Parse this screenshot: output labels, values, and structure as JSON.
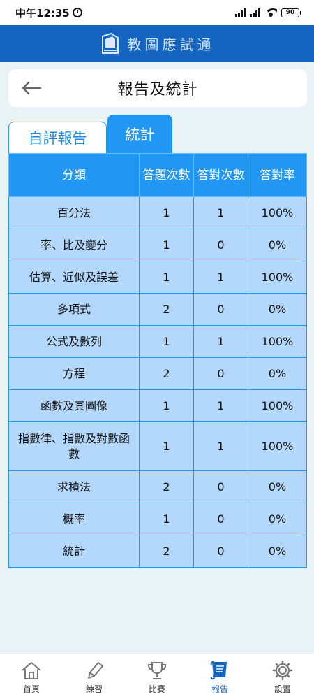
{
  "status_bar": {
    "time": "中午12:35",
    "battery": "90"
  },
  "header": {
    "app_title": "教圖應試通"
  },
  "page": {
    "title": "報告及統計"
  },
  "tabs": [
    {
      "label": "自評報告",
      "active": false
    },
    {
      "label": "統計",
      "active": true
    }
  ],
  "table": {
    "headers": [
      "分類",
      "答題次數",
      "答對次數",
      "答對率"
    ],
    "rows": [
      {
        "category": "百分法",
        "attempts": "1",
        "correct": "1",
        "rate": "100%"
      },
      {
        "category": "率、比及變分",
        "attempts": "1",
        "correct": "0",
        "rate": "0%"
      },
      {
        "category": "估算、近似及誤差",
        "attempts": "1",
        "correct": "1",
        "rate": "100%"
      },
      {
        "category": "多項式",
        "attempts": "2",
        "correct": "0",
        "rate": "0%"
      },
      {
        "category": "公式及數列",
        "attempts": "1",
        "correct": "1",
        "rate": "100%"
      },
      {
        "category": "方程",
        "attempts": "2",
        "correct": "0",
        "rate": "0%"
      },
      {
        "category": "函數及其圖像",
        "attempts": "1",
        "correct": "1",
        "rate": "100%"
      },
      {
        "category": "指數律、指數及對數函數",
        "attempts": "1",
        "correct": "1",
        "rate": "100%"
      },
      {
        "category": "求積法",
        "attempts": "2",
        "correct": "0",
        "rate": "0%"
      },
      {
        "category": "概率",
        "attempts": "1",
        "correct": "0",
        "rate": "0%"
      },
      {
        "category": "統計",
        "attempts": "2",
        "correct": "0",
        "rate": "0%"
      }
    ]
  },
  "bottom_nav": [
    {
      "label": "首頁",
      "icon": "home-icon"
    },
    {
      "label": "練習",
      "icon": "pencil-icon"
    },
    {
      "label": "比賽",
      "icon": "trophy-icon"
    },
    {
      "label": "報告",
      "icon": "scroll-icon",
      "active": true
    },
    {
      "label": "設置",
      "icon": "gear-icon"
    }
  ],
  "colors": {
    "header_blue": "#1565c0",
    "accent_blue": "#2196f3",
    "cell_blue": "#b3d8fb",
    "background": "#e9f3f6"
  }
}
